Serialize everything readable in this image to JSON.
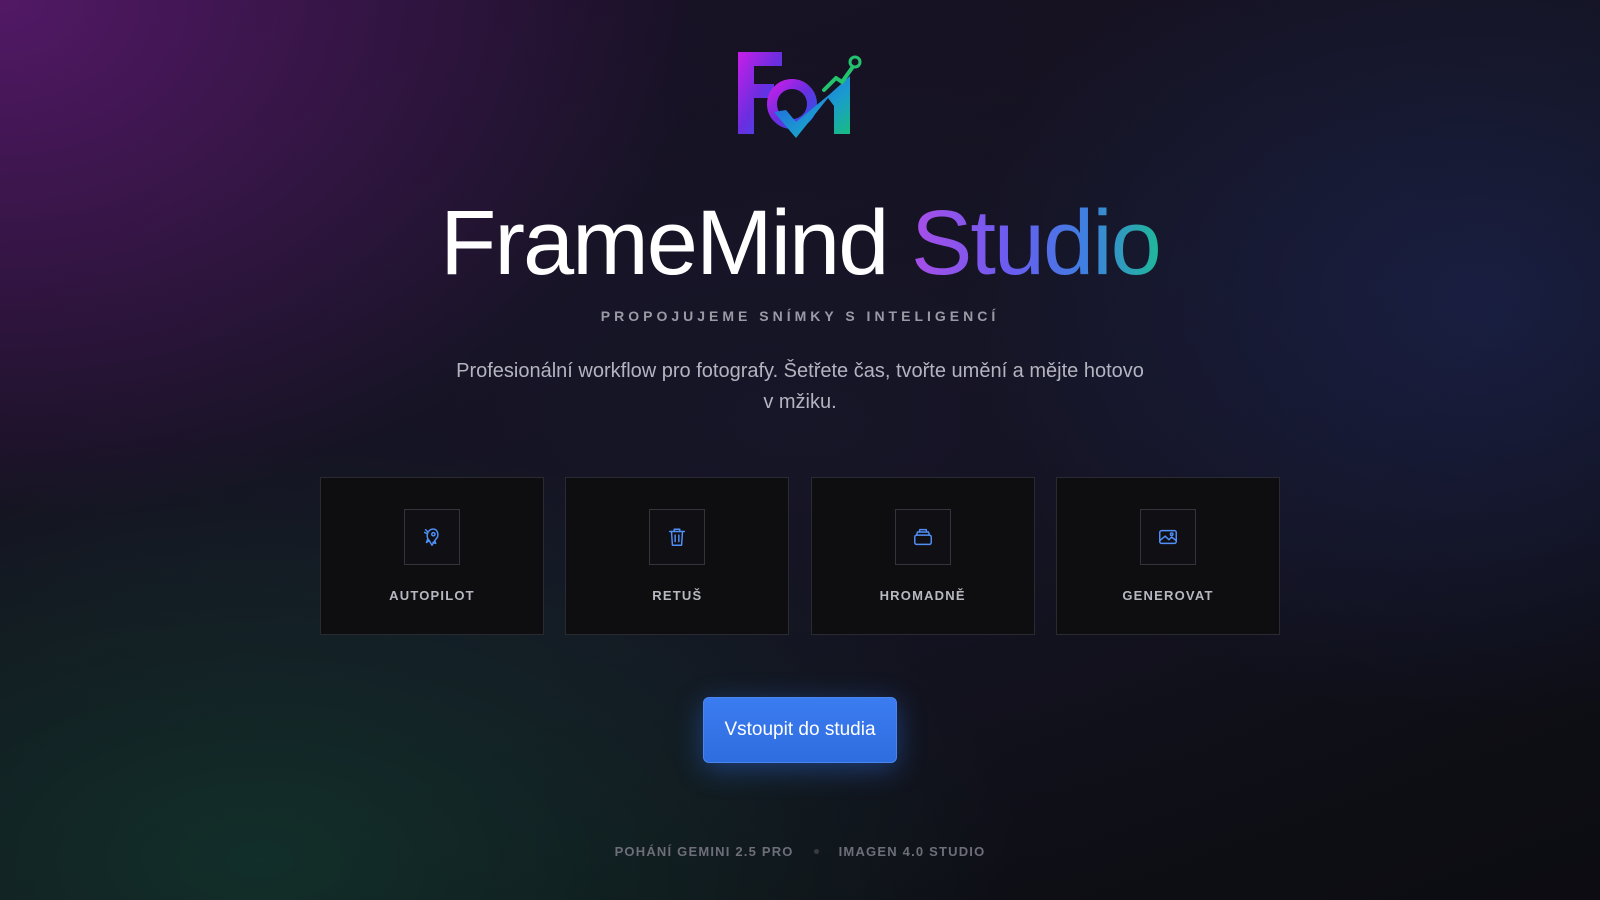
{
  "brand": {
    "logo_icon": "framemind-logo-icon",
    "title_main": "FrameMind",
    "title_accent": "Studio",
    "tagline": "PROPOJUJEME SNÍMKY S INTELIGENCÍ",
    "description": "Profesionální workflow pro fotografy. Šetřete čas, tvořte umění a mějte hotovo v mžiku."
  },
  "features": [
    {
      "label": "AUTOPILOT",
      "icon": "rocket-icon"
    },
    {
      "label": "RETUŠ",
      "icon": "trash-icon"
    },
    {
      "label": "HROMADNĚ",
      "icon": "stack-icon"
    },
    {
      "label": "GENEROVAT",
      "icon": "image-icon"
    }
  ],
  "cta": {
    "label": "Vstoupit do studia"
  },
  "footer": {
    "left": "POHÁNÍ GEMINI 2.5 PRO",
    "right": "IMAGEN 4.0 STUDIO"
  },
  "colors": {
    "accent_blue": "#2e6de0",
    "gradient_purple": "#a94ee8",
    "gradient_teal": "#1fb89a",
    "icon_blue": "#4f8ff7"
  }
}
